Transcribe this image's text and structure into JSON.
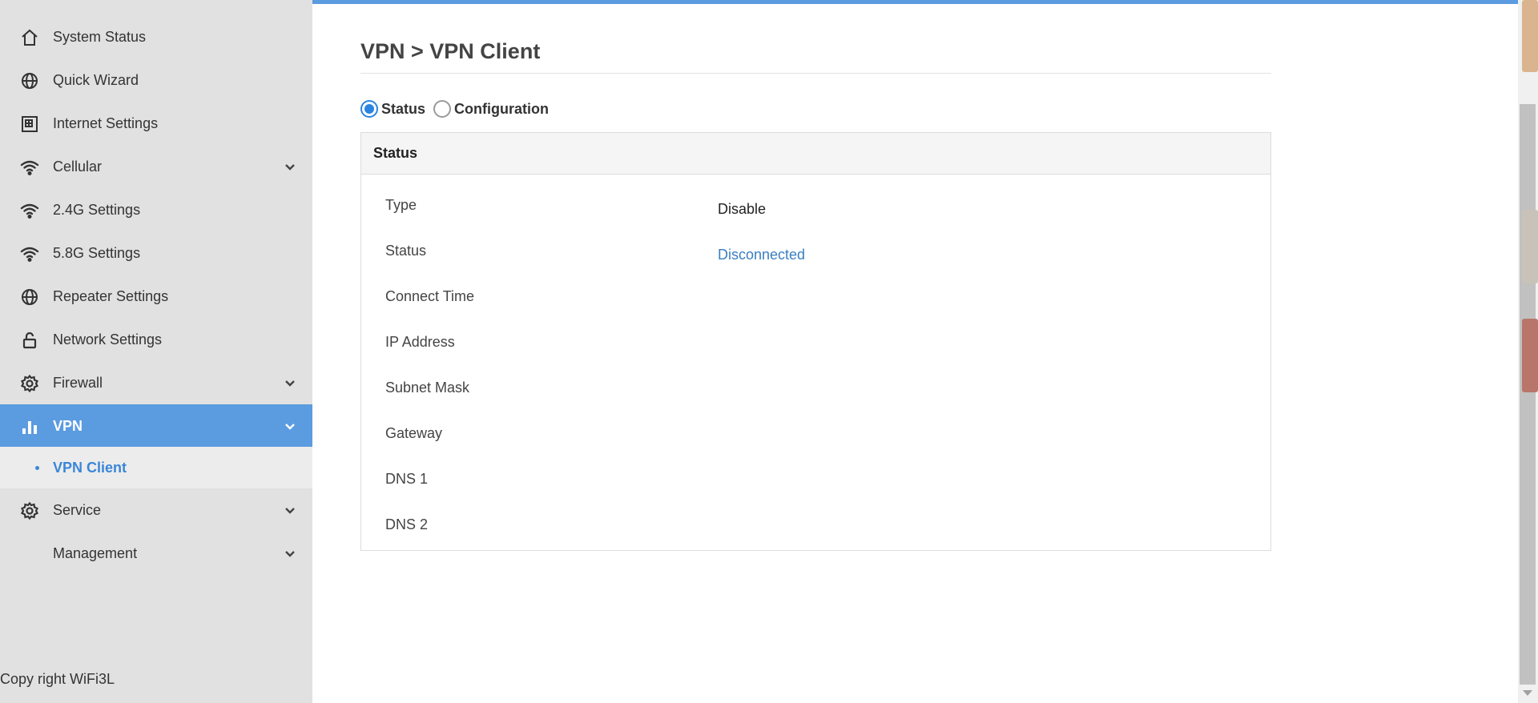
{
  "sidebar": {
    "items": [
      {
        "label": "System Status",
        "icon": "home-icon"
      },
      {
        "label": "Quick Wizard",
        "icon": "globe-icon"
      },
      {
        "label": "Internet Settings",
        "icon": "internet-icon"
      },
      {
        "label": "Cellular",
        "icon": "wifi-icon",
        "expandable": true
      },
      {
        "label": "2.4G Settings",
        "icon": "wifi-icon"
      },
      {
        "label": "5.8G Settings",
        "icon": "wifi-icon"
      },
      {
        "label": "Repeater Settings",
        "icon": "globe-icon"
      },
      {
        "label": "Network Settings",
        "icon": "lock-icon"
      },
      {
        "label": "Firewall",
        "icon": "gear-icon",
        "expandable": true
      },
      {
        "label": "VPN",
        "icon": "bar-chart-icon",
        "expandable": true,
        "active": true
      },
      {
        "label": "Service",
        "icon": "gear-icon",
        "expandable": true
      },
      {
        "label": "Management",
        "icon": "",
        "expandable": true
      }
    ],
    "sub_item": {
      "label": "VPN Client"
    },
    "copyright": "Copy right WiFi3L"
  },
  "main": {
    "title": "VPN > VPN Client",
    "radios": [
      {
        "label": "Status",
        "checked": true
      },
      {
        "label": "Configuration",
        "checked": false
      }
    ],
    "panel": {
      "heading": "Status",
      "rows": [
        {
          "key": "Type",
          "value": "Disable"
        },
        {
          "key": "Status",
          "value": "Disconnected"
        },
        {
          "key": "Connect Time",
          "value": ""
        },
        {
          "key": "IP Address",
          "value": ""
        },
        {
          "key": "Subnet Mask",
          "value": ""
        },
        {
          "key": "Gateway",
          "value": ""
        },
        {
          "key": "DNS 1",
          "value": ""
        },
        {
          "key": "DNS 2",
          "value": ""
        }
      ]
    }
  },
  "colors": {
    "accent": "#5b9be0",
    "sidebar_bg": "#e1e1e1",
    "link": "#3a7fc0"
  }
}
